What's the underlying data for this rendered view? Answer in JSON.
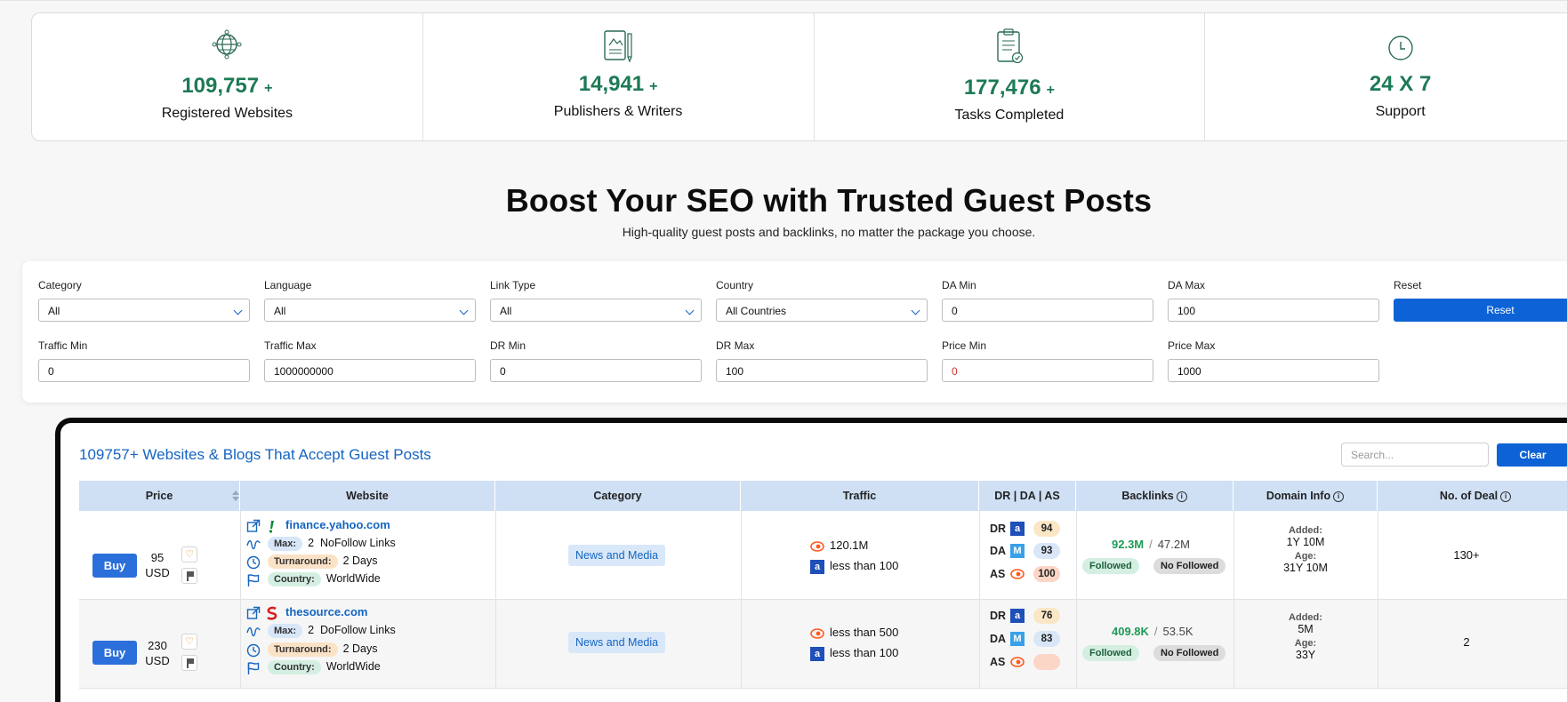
{
  "stats": [
    {
      "icon": "globe-icon",
      "number": "109,757",
      "plus": "+",
      "label": "Registered Websites"
    },
    {
      "icon": "document-pencil-icon",
      "number": "14,941",
      "plus": "+",
      "label": "Publishers & Writers"
    },
    {
      "icon": "clipboard-check-icon",
      "number": "177,476",
      "plus": "+",
      "label": "Tasks Completed"
    },
    {
      "icon": "clock-icon",
      "number": "24 X 7",
      "plus": "",
      "label": "Support"
    }
  ],
  "hero": {
    "title": "Boost Your SEO with Trusted Guest Posts",
    "subtitle": "High-quality guest posts and backlinks, no matter the package you choose."
  },
  "filters": {
    "category": {
      "label": "Category",
      "value": "All"
    },
    "language": {
      "label": "Language",
      "value": "All"
    },
    "link_type": {
      "label": "Link Type",
      "value": "All"
    },
    "country": {
      "label": "Country",
      "value": "All Countries"
    },
    "da_min": {
      "label": "DA Min",
      "value": "0"
    },
    "da_max": {
      "label": "DA Max",
      "value": "100"
    },
    "reset": {
      "label": "Reset",
      "button": "Reset"
    },
    "traffic_min": {
      "label": "Traffic Min",
      "value": "0"
    },
    "traffic_max": {
      "label": "Traffic Max",
      "value": "1000000000"
    },
    "dr_min": {
      "label": "DR Min",
      "value": "0"
    },
    "dr_max": {
      "label": "DR Max",
      "value": "100"
    },
    "price_min": {
      "label": "Price Min",
      "value": "0"
    },
    "price_max": {
      "label": "Price Max",
      "value": "1000"
    }
  },
  "table": {
    "title": "109757+ Websites & Blogs That Accept Guest Posts",
    "search_placeholder": "Search...",
    "clear_label": "Clear",
    "columns": [
      "Price",
      "Website",
      "Category",
      "Traffic",
      "DR | DA | AS",
      "Backlinks",
      "Domain Info",
      "No. of Deal"
    ],
    "rows": [
      {
        "buy": "Buy",
        "price": "95",
        "currency": "USD",
        "site": "finance.yahoo.com",
        "max_tag": "Max:",
        "max_value": "2",
        "link_kind": "NoFollow Links",
        "turn_tag": "Turnaround:",
        "turn_value": "2 Days",
        "country_tag": "Country:",
        "country_value": "WorldWide",
        "category": "News and Media",
        "traffic_semrush": "120.1M",
        "traffic_ahrefs": "less than 100",
        "dr_label": "DR",
        "dr": "94",
        "da_label": "DA",
        "da": "93",
        "as_label": "AS",
        "as": "100",
        "backlinks_followed": "92.3M",
        "backlinks_sep": "/",
        "backlinks_nofollowed": "47.2M",
        "followed_label": "Followed",
        "nofollowed_label": "No Followed",
        "added_label": "Added:",
        "added": "1Y 10M",
        "age_label": "Age:",
        "age": "31Y 10M",
        "deals": "130+"
      },
      {
        "buy": "Buy",
        "price": "230",
        "currency": "USD",
        "site": "thesource.com",
        "max_tag": "Max:",
        "max_value": "2",
        "link_kind": "DoFollow Links",
        "turn_tag": "Turnaround:",
        "turn_value": "2 Days",
        "country_tag": "Country:",
        "country_value": "WorldWide",
        "category": "News and Media",
        "traffic_semrush": "less than 500",
        "traffic_ahrefs": "less than 100",
        "dr_label": "DR",
        "dr": "76",
        "da_label": "DA",
        "da": "83",
        "as_label": "AS",
        "as": "",
        "backlinks_followed": "409.8K",
        "backlinks_sep": "/",
        "backlinks_nofollowed": "53.5K",
        "followed_label": "Followed",
        "nofollowed_label": "No Followed",
        "added_label": "Added:",
        "added": "5M",
        "age_label": "Age:",
        "age": "33Y",
        "deals": "2"
      }
    ]
  },
  "colors": {
    "accent": "#0d63d5",
    "stat_green": "#1d7a55",
    "link_blue": "#1565c0",
    "header_bg": "#cfe0f5"
  }
}
